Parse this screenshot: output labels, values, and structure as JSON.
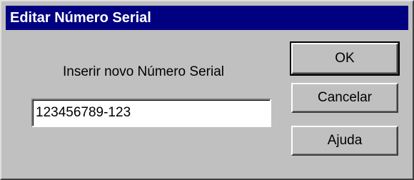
{
  "dialog": {
    "title": "Editar Número Serial",
    "prompt_label": "Inserir novo Número Serial",
    "serial_value": "123456789-123"
  },
  "buttons": {
    "ok_label": "OK",
    "cancel_label": "Cancelar",
    "help_label": "Ajuda"
  },
  "colors": {
    "titlebar": "#000080",
    "face": "#c0c0c0"
  }
}
